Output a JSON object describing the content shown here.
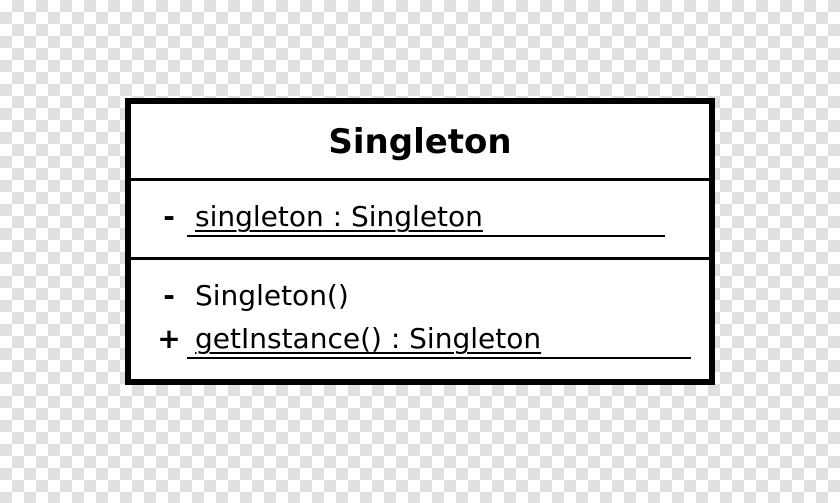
{
  "uml": {
    "class_name": "Singleton",
    "attributes": [
      {
        "visibility": "-",
        "signature": "singleton : Singleton",
        "static": true
      }
    ],
    "operations": [
      {
        "visibility": "-",
        "signature": "Singleton()",
        "static": false
      },
      {
        "visibility": "+",
        "signature": "getInstance() : Singleton",
        "static": true
      }
    ]
  }
}
